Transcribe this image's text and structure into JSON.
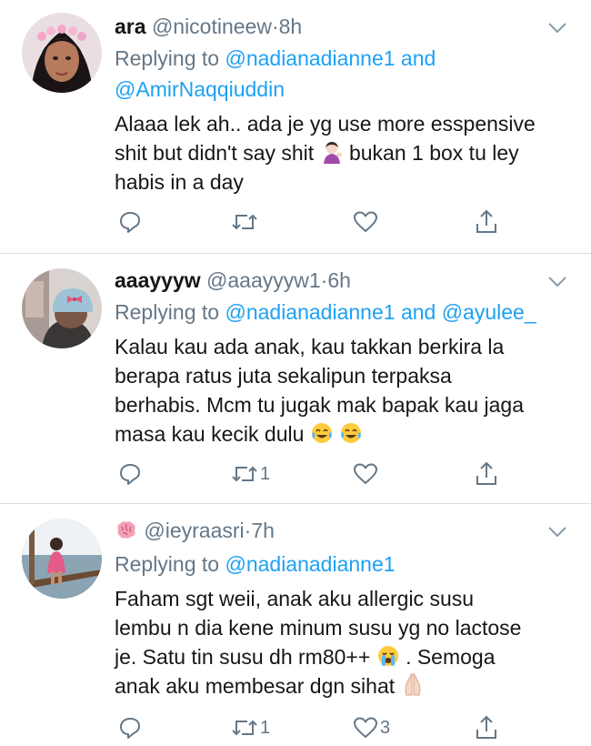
{
  "tweets": [
    {
      "name": "ara",
      "handle": "@nicotineew",
      "separator": "·",
      "time": "8h",
      "replying_prefix": "Replying to",
      "replying_line1": "@nadianadianne1 and",
      "replying_line2": "@AmirNaqqiuddin",
      "body_lines": [
        "Alaaa lek ah.. ada je yg use more esspensive",
        "shit but didn't say shit",
        "bukan 1 box tu ley",
        "habis in a day"
      ],
      "actions": {
        "reply_count": "",
        "retweet_count": "",
        "like_count": ""
      }
    },
    {
      "name": "aaayyyw",
      "handle": "@aaayyyw1",
      "separator": "·",
      "time": "6h",
      "replying_prefix": "Replying to",
      "replying_mention1": "@nadianadianne1",
      "replying_and": "and",
      "replying_mention2": "@ayulee_",
      "body_lines": [
        "Kalau kau ada anak, kau takkan berkira la",
        "berapa ratus juta sekalipun terpaksa",
        "berhabis. Mcm tu jugak mak bapak kau jaga",
        "masa kau kecik dulu"
      ],
      "actions": {
        "reply_count": "",
        "retweet_count": "1",
        "like_count": ""
      }
    },
    {
      "name": "",
      "handle": "@ieyraasri",
      "separator": "·",
      "time": "7h",
      "replying_prefix": "Replying to",
      "replying_mention1": "@nadianadianne1",
      "body_lines": [
        "Faham sgt weii, anak aku allergic susu",
        "lembu n dia kene minum susu yg no lactose",
        "je. Satu tin susu dh rm80++",
        ". Semoga",
        "anak aku membesar dgn sihat"
      ],
      "actions": {
        "reply_count": "",
        "retweet_count": "1",
        "like_count": "3"
      }
    }
  ],
  "colors": {
    "link": "#1da1f2",
    "secondary": "#657786",
    "text": "#14171a",
    "divider": "#d8dde2"
  },
  "icons": [
    "reply-icon",
    "retweet-icon",
    "like-icon",
    "share-icon",
    "chevron-down-icon",
    "brain-emoji",
    "woman-tipping-hand-emoji",
    "tears-of-joy-emoji",
    "crying-emoji",
    "folded-hands-emoji"
  ]
}
